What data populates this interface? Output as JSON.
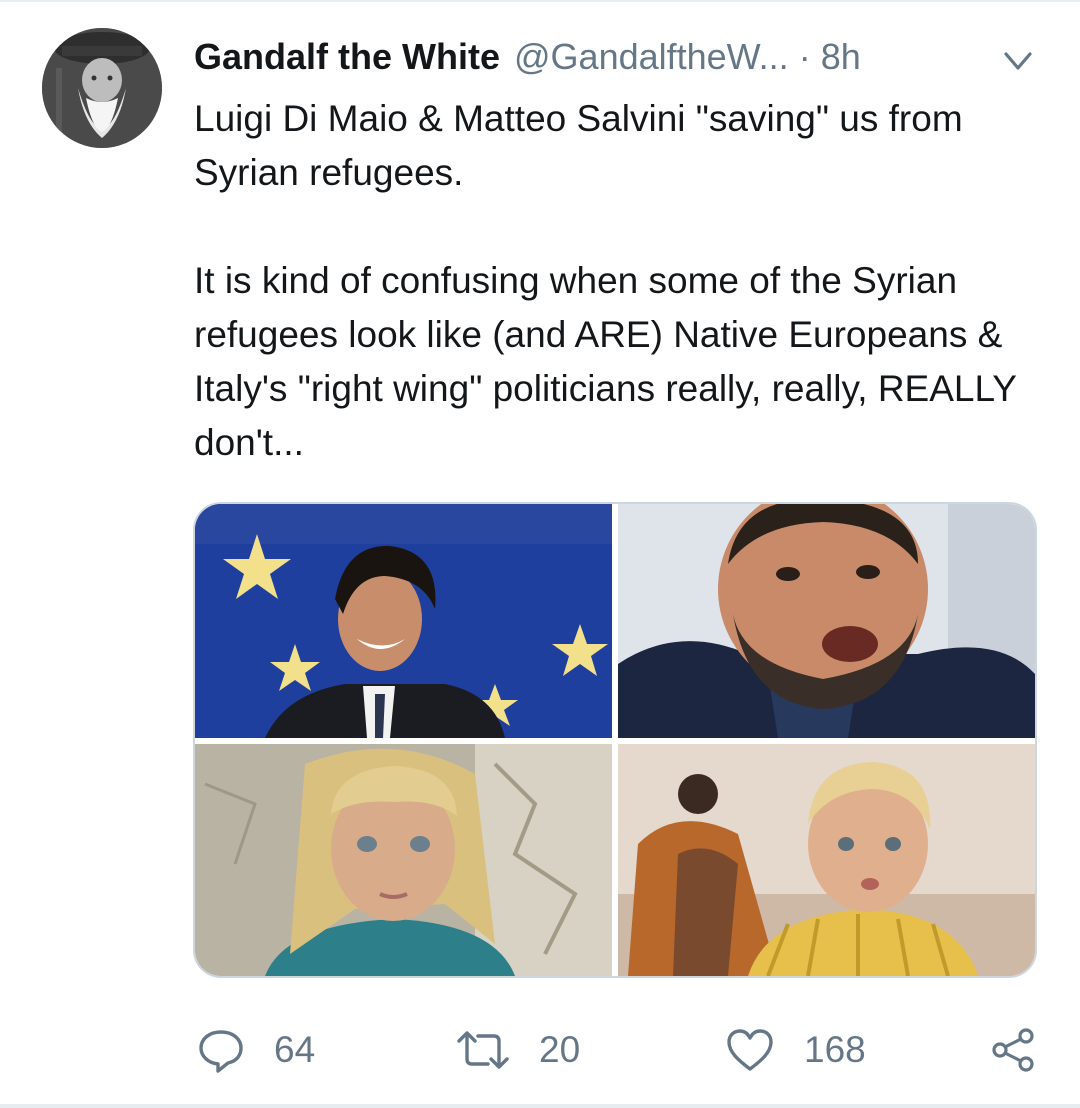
{
  "tweet": {
    "author_name": "Gandalf the White",
    "handle": "@GandalftheW...",
    "separator": "·",
    "time": "8h",
    "paragraphs": [
      "Luigi Di Maio & Matteo Salvini \"saving\" us from Syrian refugees.",
      "It is kind of confusing when some of the Syrian refugees look like (and ARE) Native Europeans & Italy's \"right wing\" politicians really, really, REALLY don't..."
    ]
  },
  "actions": {
    "reply_count": "64",
    "retweet_count": "20",
    "like_count": "168",
    "icons": [
      "reply-icon",
      "retweet-icon",
      "like-icon",
      "share-icon"
    ]
  },
  "colors": {
    "text": "#14171a",
    "secondary": "#657786",
    "border": "#ccd6dd",
    "eu_blue": "#1f3f9e",
    "eu_star": "#f3e08a"
  }
}
